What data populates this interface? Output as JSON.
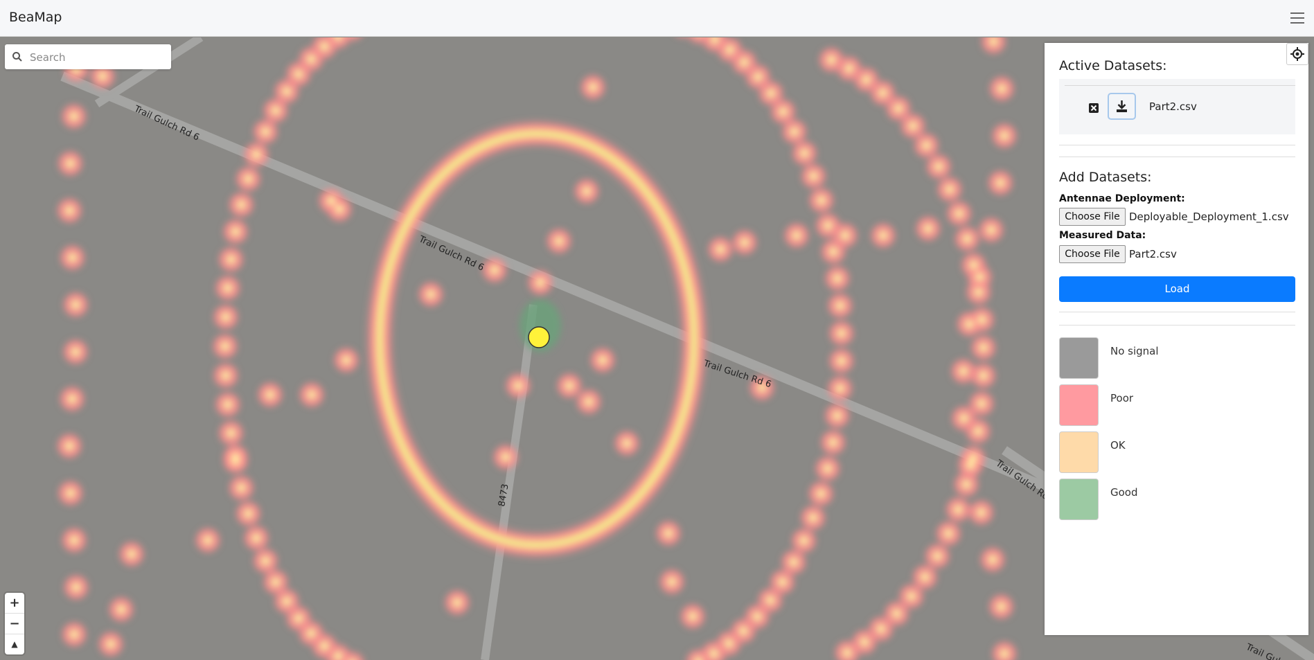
{
  "app": {
    "title": "BeaMap"
  },
  "header": {
    "menu_icon": "hamburger-icon"
  },
  "search": {
    "placeholder": "Search",
    "icon": "search-icon"
  },
  "map": {
    "road_labels": [
      "Trail Gulch Rd 6",
      "Trail Gulch Rd 6",
      "Trail Gulch Rd 6",
      "Trail Gulch Rd 6",
      "Trail Gulch Rd 6",
      "8473"
    ],
    "zoom_in": "+",
    "zoom_out": "−",
    "compass": "▲"
  },
  "panel": {
    "active_title": "Active Datasets:",
    "active_datasets": [
      {
        "name": "Part2.csv",
        "remove_icon": "remove-icon",
        "download_icon": "download-icon"
      }
    ],
    "add_title": "Add Datasets:",
    "antennae_label": "Antennae Deployment:",
    "antennae_file": "Deployable_Deployment_1.csv",
    "measured_label": "Measured Data:",
    "measured_file": "Part2.csv",
    "choose_file": "Choose File",
    "load": "Load",
    "locate_icon": "crosshair-icon",
    "legend": [
      {
        "label": "No signal",
        "color": "#9a9a9a"
      },
      {
        "label": "Poor",
        "color": "#ff9aa0"
      },
      {
        "label": "OK",
        "color": "#fedaa9"
      },
      {
        "label": "Good",
        "color": "#9ccaa3"
      }
    ]
  }
}
